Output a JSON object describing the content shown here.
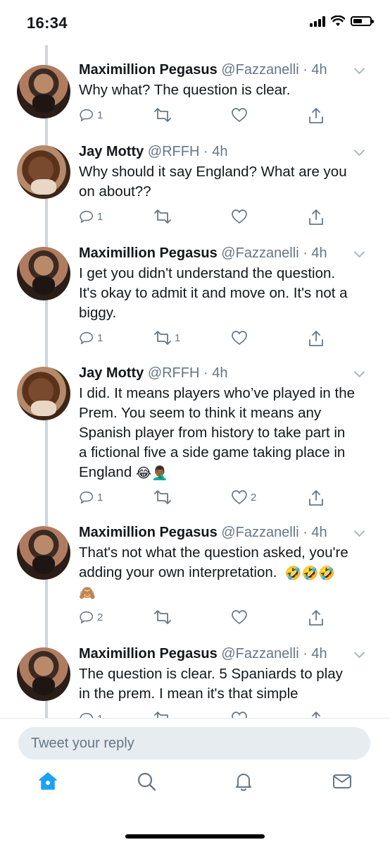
{
  "status_bar": {
    "time": "16:34"
  },
  "tweets": [
    {
      "avatar": "maxim",
      "name": "Maximillion Pegasus",
      "handle": "@Fazzanelli",
      "time": "4h",
      "lines": [
        "Why what? The question is clear."
      ],
      "reply_count": "1",
      "retweet_count": "",
      "like_count": ""
    },
    {
      "avatar": "jay",
      "name": "Jay Motty",
      "handle": "@RFFH",
      "time": "4h",
      "lines": [
        "Why should it say England? What are you",
        "on about??"
      ],
      "reply_count": "1",
      "retweet_count": "",
      "like_count": ""
    },
    {
      "avatar": "maxim",
      "name": "Maximillion Pegasus",
      "handle": "@Fazzanelli",
      "time": "4h",
      "lines": [
        "I get you didn't understand the question.",
        "It's okay to admit it and move on. It's not a",
        "biggy."
      ],
      "reply_count": "1",
      "retweet_count": "1",
      "like_count": ""
    },
    {
      "avatar": "jay",
      "name": "Jay Motty",
      "handle": "@RFFH",
      "time": "4h",
      "lines": [
        "I did. It means players who’ve played in the",
        "Prem. You seem to think it means any",
        "Spanish player from history to take part in",
        "a fictional five a side game taking place in",
        "England"
      ],
      "emoji_end": "😂🤦🏾‍♂️",
      "reply_count": "1",
      "retweet_count": "",
      "like_count": "2"
    },
    {
      "avatar": "maxim",
      "name": "Maximillion Pegasus",
      "handle": "@Fazzanelli",
      "time": "4h",
      "lines": [
        "That's not what the question asked, you're",
        "adding your own interpretation."
      ],
      "emoji_line2": "🤣🤣🤣",
      "emoji_line3": "🙈",
      "reply_count": "2",
      "retweet_count": "",
      "like_count": ""
    },
    {
      "avatar": "maxim",
      "name": "Maximillion Pegasus",
      "handle": "@Fazzanelli",
      "time": "4h",
      "lines": [
        "The question is clear. 5 Spaniards to play",
        "in  the prem. I mean it's that simple"
      ],
      "reply_count": "1",
      "retweet_count": "",
      "like_count": ""
    }
  ],
  "reply_bar": {
    "placeholder": "Tweet your reply"
  },
  "tabs": [
    {
      "icon": "home-icon",
      "active": true
    },
    {
      "icon": "search-icon",
      "active": false
    },
    {
      "icon": "notifications-icon",
      "active": false
    },
    {
      "icon": "messages-icon",
      "active": false
    }
  ],
  "colors": {
    "accent": "#1da1f2",
    "muted": "#657786",
    "thread_line": "#ccd6dd"
  }
}
